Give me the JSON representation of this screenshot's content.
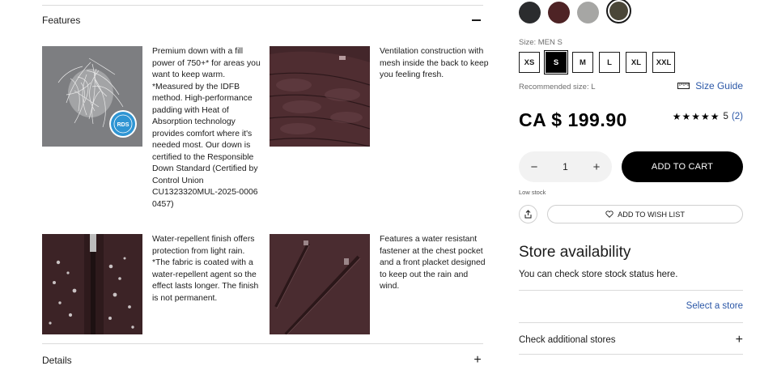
{
  "features": {
    "title": "Features",
    "collapse_symbol": "−",
    "items": [
      {
        "text": "Premium down with a fill power of 750+* for areas you want to keep warm. *Measured by the IDFB method. High-performance padding with Heat of Absorption technology provides comfort where it's needed most. Our down is certified to the Responsible Down Standard (Certified by Control Union CU1323320MUL-2025-0006 0457)",
        "badge": "RDS",
        "image": "down-feathers"
      },
      {
        "text": "Ventilation construction with mesh inside the back to keep you feeling fresh.",
        "image": "jacket-back-mesh"
      },
      {
        "text": "Water-repellent finish offers protection from light rain. *The fabric is coated with a water-repellent agent so the effect lasts longer. The finish is not permanent.",
        "image": "water-droplets-fabric"
      },
      {
        "text": "Features a water resistant fastener at the chest pocket and a front placket designed to keep out the rain and wind.",
        "image": "chest-pocket-zipper"
      }
    ]
  },
  "details": {
    "title": "Details",
    "expand_symbol": "+"
  },
  "colors": [
    {
      "name": "black",
      "hex": "#2b2c2e"
    },
    {
      "name": "burgundy",
      "hex": "#4e2325"
    },
    {
      "name": "gray",
      "hex": "#a6a6a4"
    },
    {
      "name": "olive",
      "hex": "#4a4638",
      "selected": true
    }
  ],
  "size": {
    "label": "Size: MEN S",
    "options": [
      "XS",
      "S",
      "M",
      "L",
      "XL",
      "XXL"
    ],
    "selected": "S",
    "recommended": "Recommended size: L",
    "guide_label": "Size Guide",
    "guide_icon": "ruler-icon"
  },
  "price": "CA $ 199.90",
  "rating": {
    "stars": "★★★★★",
    "score": "5",
    "count": "(2)"
  },
  "quantity": {
    "minus": "−",
    "value": "1",
    "plus": "+"
  },
  "add_to_cart": "ADD TO CART",
  "stock_status": "Low stock",
  "wish_list": "ADD TO WISH LIST",
  "store": {
    "title": "Store availability",
    "subtitle": "You can check store stock status here.",
    "select_label": "Select a store",
    "check_more_label": "Check additional stores",
    "expand_symbol": "+"
  }
}
